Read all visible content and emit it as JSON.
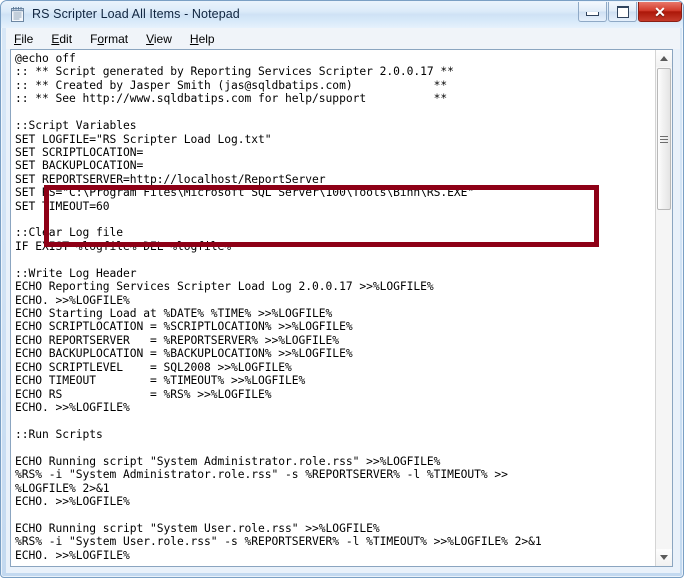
{
  "window": {
    "title": "RS Scripter Load All Items - Notepad",
    "icon": "notepad-icon",
    "controls": {
      "minimize_label": "–",
      "maximize_label": "□",
      "close_label": "✕"
    }
  },
  "menubar": {
    "items": [
      {
        "label": "File",
        "accel": "F"
      },
      {
        "label": "Edit",
        "accel": "E"
      },
      {
        "label": "Format",
        "accel": "o"
      },
      {
        "label": "View",
        "accel": "V"
      },
      {
        "label": "Help",
        "accel": "H"
      }
    ]
  },
  "editor": {
    "content": "@echo off\n:: ** Script generated by Reporting Services Scripter 2.0.0.17 **\n:: ** Created by Jasper Smith (jas@sqldbatips.com)            **\n:: ** See http://www.sqldbatips.com for help/support          **\n\n::Script Variables\nSET LOGFILE=\"RS Scripter Load Log.txt\"\nSET SCRIPTLOCATION=\nSET BACKUPLOCATION=\nSET REPORTSERVER=http://localhost/ReportServer\nSET RS=\"C:\\Program Files\\Microsoft SQL Server\\100\\Tools\\Binn\\RS.EXE\"\nSET TIMEOUT=60\n\n::Clear Log file\nIF EXIST %logfile% DEL %logfile%\n\n::Write Log Header\nECHO Reporting Services Scripter Load Log 2.0.0.17 >>%LOGFILE%\nECHO. >>%LOGFILE%\nECHO Starting Load at %DATE% %TIME% >>%LOGFILE%\nECHO SCRIPTLOCATION = %SCRIPTLOCATION% >>%LOGFILE%\nECHO REPORTSERVER   = %REPORTSERVER% >>%LOGFILE%\nECHO BACKUPLOCATION = %BACKUPLOCATION% >>%LOGFILE%\nECHO SCRIPTLEVEL    = SQL2008 >>%LOGFILE%\nECHO TIMEOUT        = %TIMEOUT% >>%LOGFILE%\nECHO RS             = %RS% >>%LOGFILE%\nECHO. >>%LOGFILE%\n\n::Run Scripts\n\nECHO Running script \"System Administrator.role.rss\" >>%LOGFILE%\n%RS% -i \"System Administrator.role.rss\" -s %REPORTSERVER% -l %TIMEOUT% >>\n%LOGFILE% 2>&1\nECHO. >>%LOGFILE%\n\nECHO Running script \"System User.role.rss\" >>%LOGFILE%\n%RS% -i \"System User.role.rss\" -s %REPORTSERVER% -l %TIMEOUT% >>%LOGFILE% 2>&1\nECHO. >>%LOGFILE%"
  },
  "annotation": {
    "type": "rectangle-highlight",
    "color": "#8e0016",
    "highlighted_lines": [
      "SCRIPTLOCATION=",
      "BACKUPLOCATION=",
      "REPORTSERVER=http://localhost/ReportServer",
      "RS=\"C:\\Program Files\\Microsoft SQL Server\\100\\Tools\\Binn\\RS.EXE\""
    ]
  },
  "scrollbar": {
    "up_arrow": "▲",
    "down_arrow": "▼",
    "thumb_grip": "grip-lines"
  }
}
